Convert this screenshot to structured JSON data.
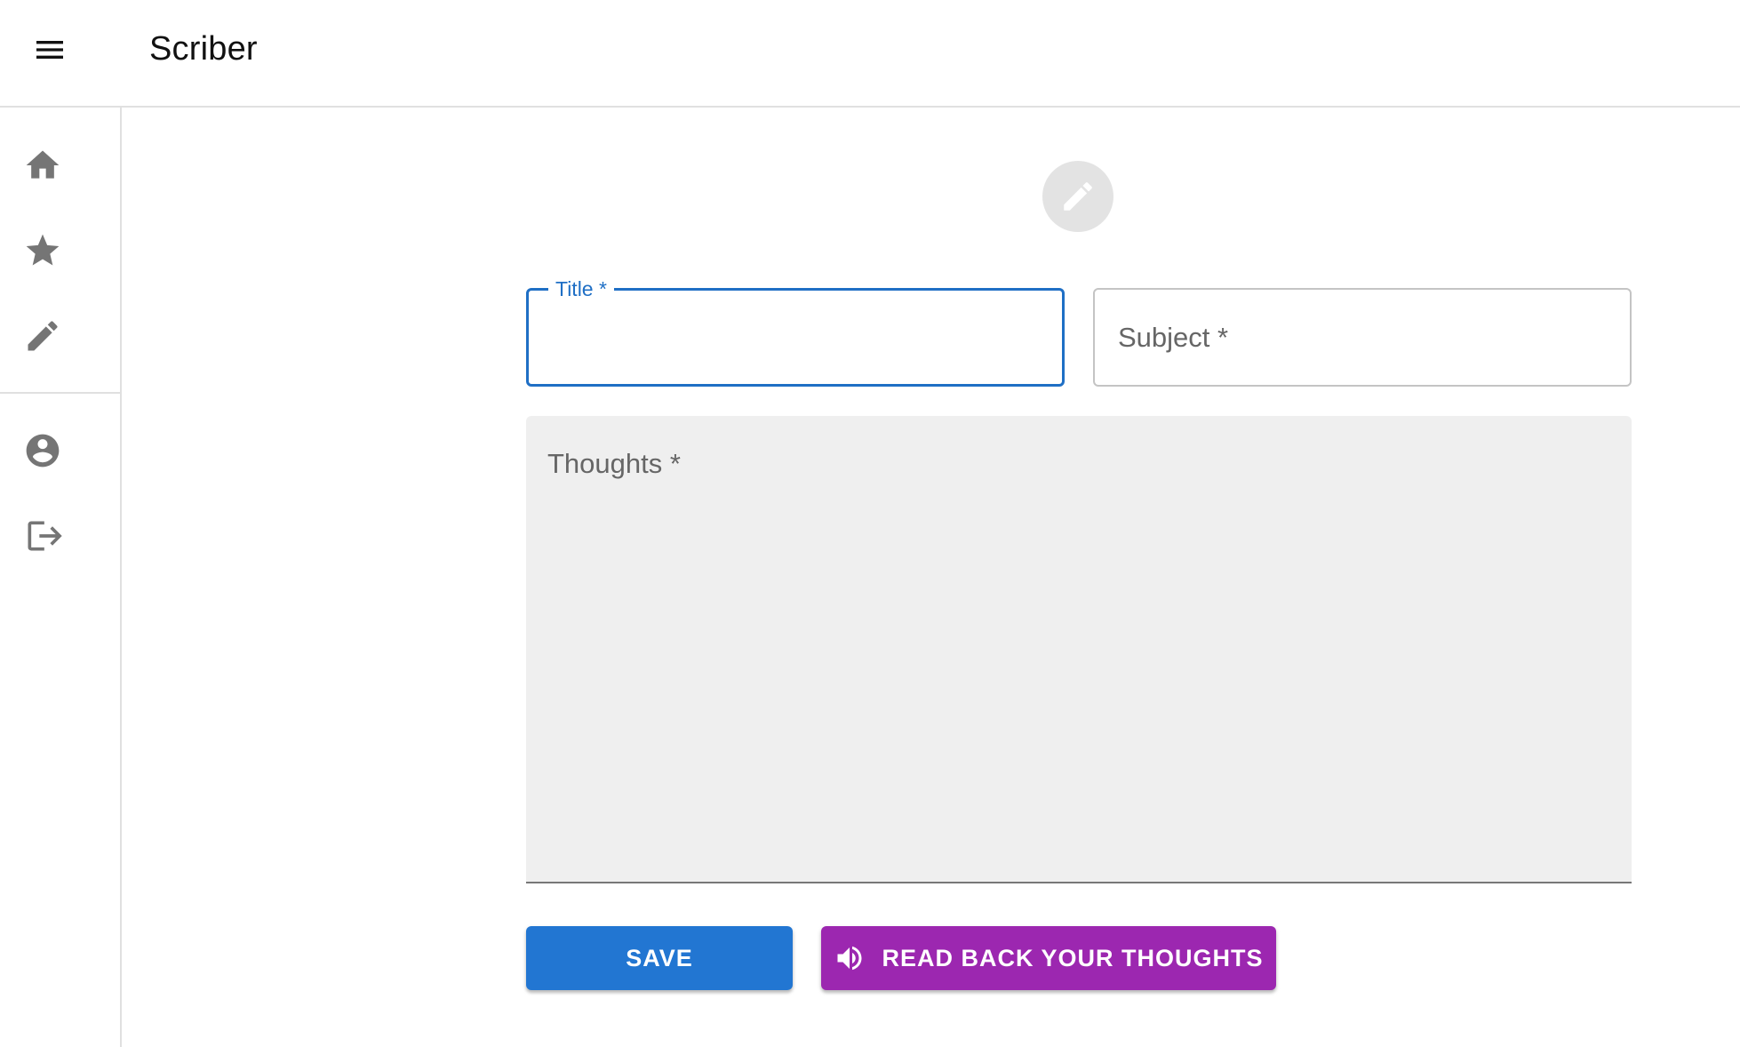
{
  "app": {
    "title": "Scriber"
  },
  "header": {
    "menu_icon": "hamburger-menu-icon"
  },
  "sidebar": {
    "items": [
      {
        "name": "home",
        "icon": "home-icon"
      },
      {
        "name": "favorites",
        "icon": "star-icon"
      },
      {
        "name": "write",
        "icon": "pencil-icon"
      },
      {
        "name": "profile",
        "icon": "account-circle-icon"
      },
      {
        "name": "logout",
        "icon": "logout-icon"
      }
    ]
  },
  "form": {
    "header_icon": "pencil-icon",
    "title_field": {
      "label": "Title *",
      "value": ""
    },
    "subject_field": {
      "label": "Subject *",
      "value": ""
    },
    "thoughts_field": {
      "label": "Thoughts *",
      "value": ""
    },
    "save_label": "SAVE",
    "read_back_label": "READ BACK YOUR THOUGHTS"
  },
  "colors": {
    "primary": "#2276d2",
    "secondary": "#9c27b0",
    "icon_gray": "#757575",
    "filled_bg": "#efefef"
  }
}
